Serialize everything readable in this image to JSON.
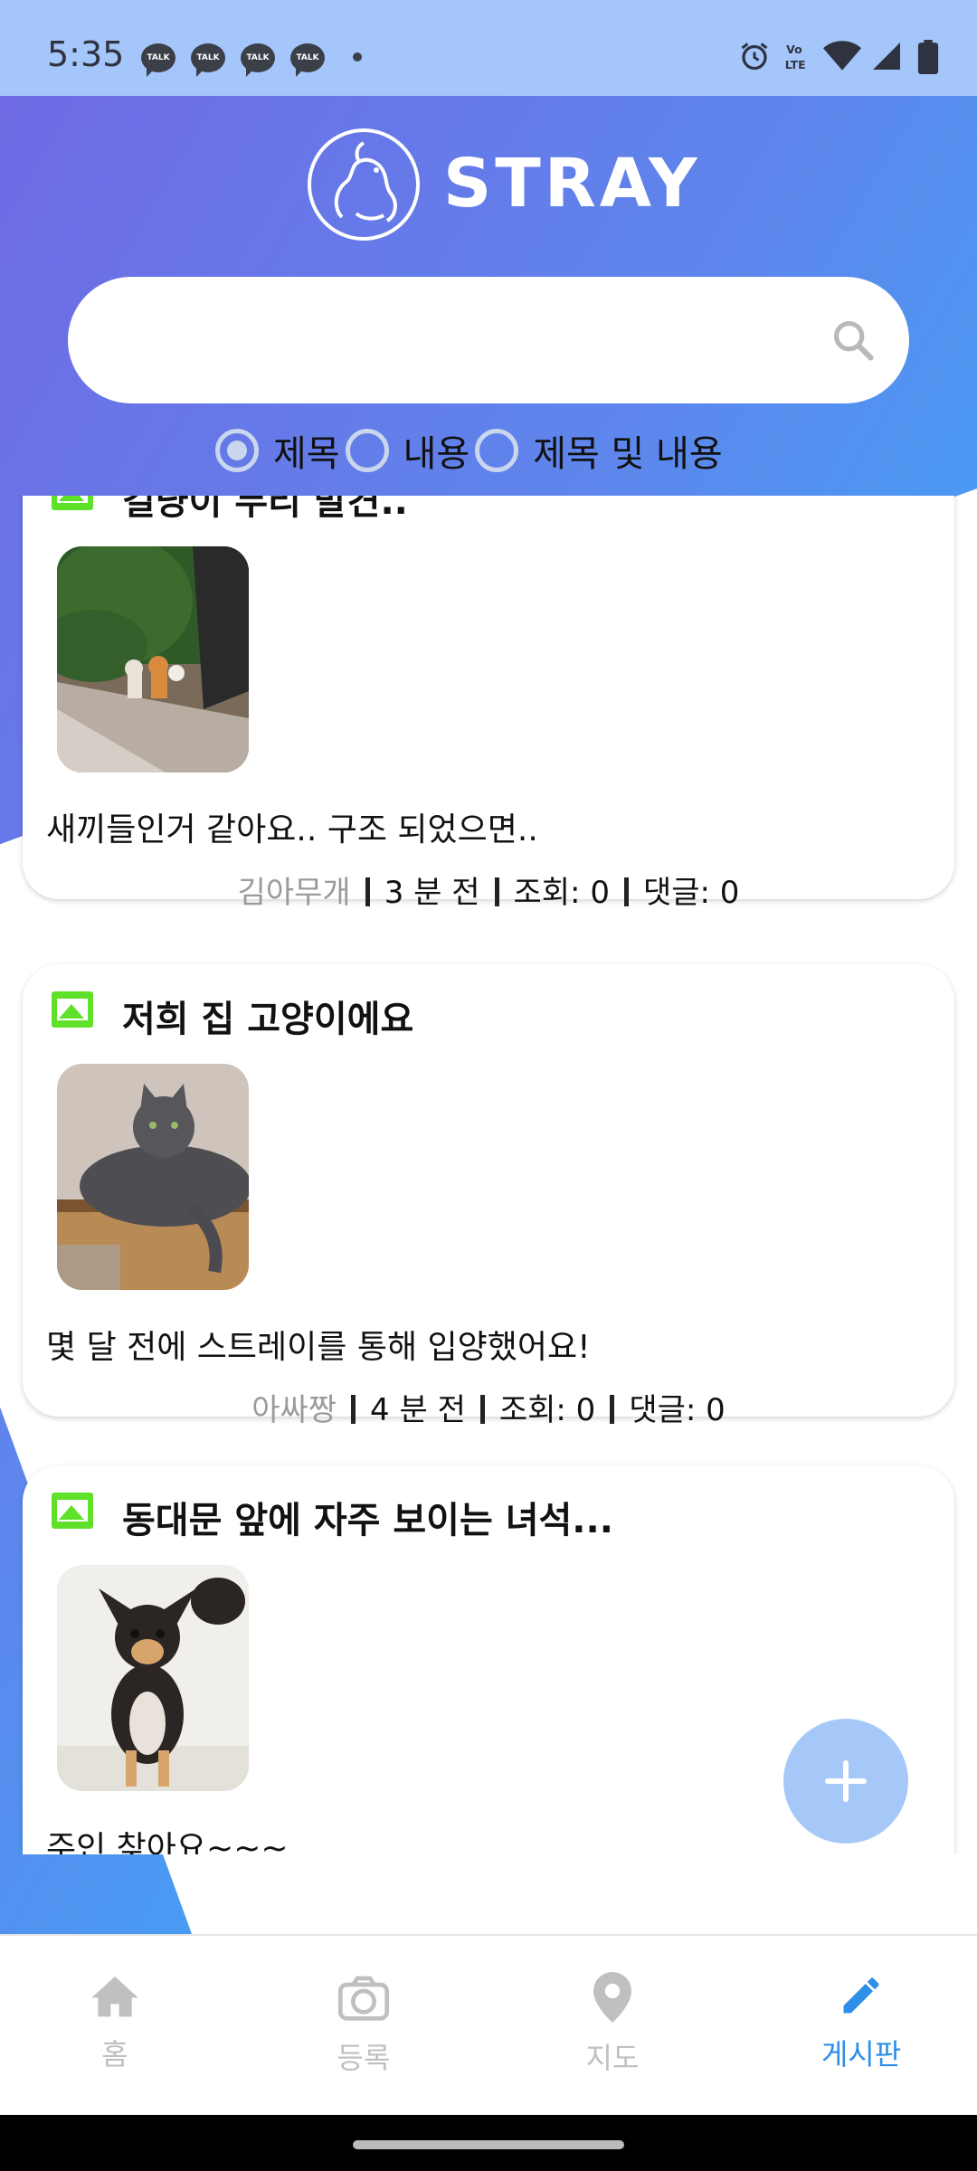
{
  "status_bar": {
    "time": "5:35",
    "notifications": [
      "TALK",
      "TALK",
      "TALK",
      "TALK"
    ],
    "icons": [
      "alarm-icon",
      "volte-icon",
      "wifi-icon",
      "signal-icon",
      "battery-icon"
    ]
  },
  "header": {
    "brand": "STRAY",
    "logo": "cat-dog-logo"
  },
  "search": {
    "value": "",
    "placeholder": ""
  },
  "filter_options": [
    {
      "label": "제목",
      "selected": true
    },
    {
      "label": "내용",
      "selected": false
    },
    {
      "label": "제목 및 내용",
      "selected": false
    }
  ],
  "posts": [
    {
      "title": "길냥이 무리 발견..",
      "body": "새끼들인거 같아요.. 구조 되었으면..",
      "author": "김아무개",
      "time": "3 분 전",
      "views": "조회: 0",
      "comments": "댓글: 0"
    },
    {
      "title": "저희 집 고양이에요",
      "body": "몇 달 전에 스트레이를 통해 입양했어요!",
      "author": "아싸짱",
      "time": "4 분 전",
      "views": "조회: 0",
      "comments": "댓글: 0"
    },
    {
      "title": "동대문 앞에 자주 보이는 녀석...",
      "body": "주인 찾아요~~~",
      "author": "",
      "time": "",
      "views": "",
      "comments": ""
    }
  ],
  "bottom_nav": [
    {
      "label": "홈",
      "icon": "home-icon",
      "active": false
    },
    {
      "label": "등록",
      "icon": "camera-icon",
      "active": false
    },
    {
      "label": "지도",
      "icon": "map-pin-icon",
      "active": false
    },
    {
      "label": "게시판",
      "icon": "pencil-icon",
      "active": true
    }
  ],
  "colors": {
    "accent": "#2d8fe8",
    "fab": "#a6c8f8",
    "image_badge": "#5fe12a",
    "status_bar": "#a5c6fb"
  }
}
